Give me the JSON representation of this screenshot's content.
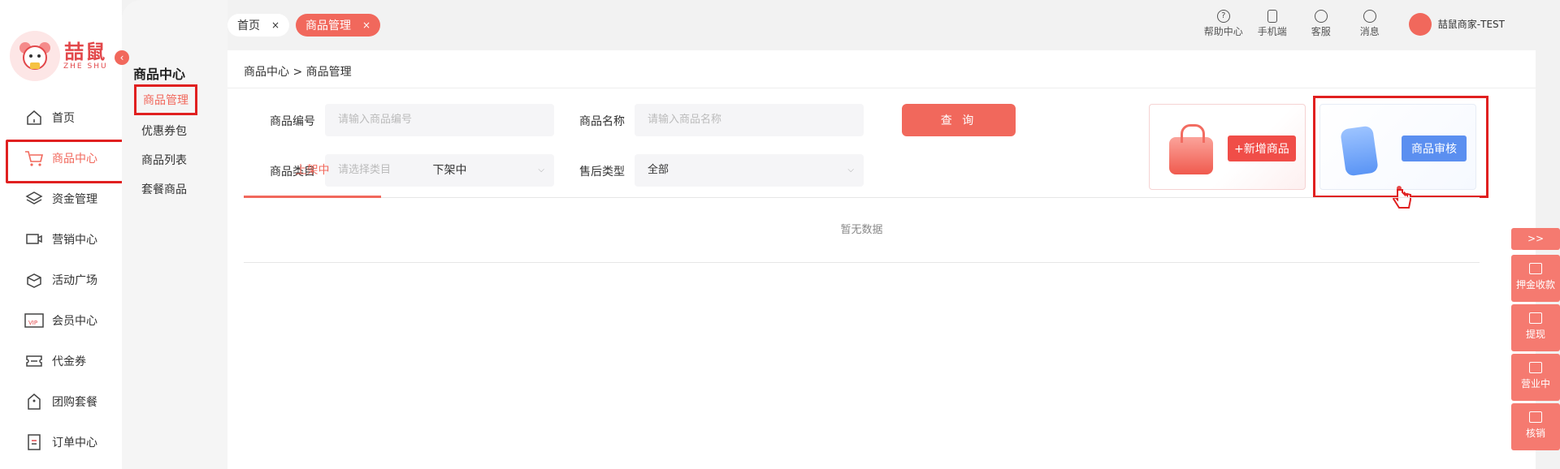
{
  "logo": {
    "cn": "喆鼠",
    "en": "ZHE SHU"
  },
  "nav": [
    {
      "label": "首页",
      "icon": "home-icon",
      "active": false
    },
    {
      "label": "商品中心",
      "icon": "cart-icon",
      "active": true
    },
    {
      "label": "资金管理",
      "icon": "layers-icon",
      "active": false
    },
    {
      "label": "营销中心",
      "icon": "monitor-icon",
      "active": false
    },
    {
      "label": "活动广场",
      "icon": "box-icon",
      "active": false
    },
    {
      "label": "会员中心",
      "icon": "vip-icon",
      "active": false
    },
    {
      "label": "代金券",
      "icon": "ticket-icon",
      "active": false
    },
    {
      "label": "团购套餐",
      "icon": "bag-icon",
      "active": false
    },
    {
      "label": "订单中心",
      "icon": "list-icon",
      "active": false
    }
  ],
  "submenu": {
    "title": "商品中心",
    "items": [
      "商品管理",
      "优惠券包",
      "商品列表",
      "套餐商品"
    ]
  },
  "topbar": {
    "tabs": {
      "home": "首页",
      "current": "商品管理",
      "close": "×"
    },
    "tools": [
      "帮助中心",
      "手机端",
      "客服",
      "消息"
    ],
    "user": "喆鼠商家-TEST"
  },
  "main": {
    "breadcrumb": "商品中心 > 商品管理",
    "filters": {
      "code_label": "商品编号",
      "code_placeholder": "请输入商品编号",
      "name_label": "商品名称",
      "name_placeholder": "请输入商品名称",
      "category_label": "商品类目",
      "category_placeholder": "请选择类目",
      "aftersale_label": "售后类型",
      "aftersale_value": "全部"
    },
    "query_label": "查 询",
    "cards": {
      "add": "+新增商品",
      "review": "商品审核"
    },
    "tabs": [
      "上架中",
      "下架中"
    ],
    "empty": "暂无数据"
  },
  "float": {
    "toggle": ">>",
    "items": [
      "押金收款",
      "提现",
      "营业中",
      "核销"
    ]
  },
  "colors": {
    "accent": "#f1685c",
    "highlight": "#e02020",
    "review_blue": "#5b8ff0"
  }
}
